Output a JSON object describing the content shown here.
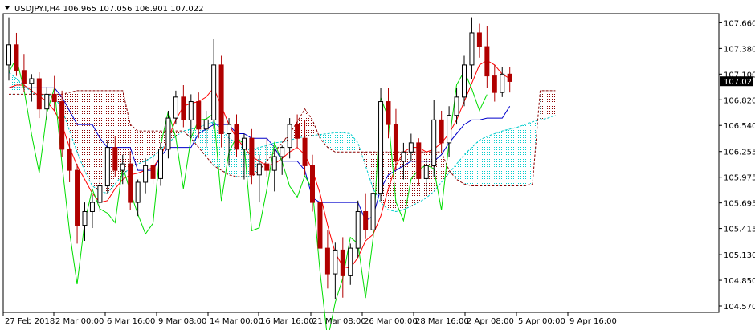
{
  "window": {
    "symbol_line": "USDJPY.I,H4  106.965 107.056 106.901 107.022",
    "menu_arrow_icon": "triangle-down-icon"
  },
  "price_axis": {
    "ticks": [
      "107.660",
      "107.380",
      "107.100",
      "106.820",
      "106.540",
      "106.255",
      "105.975",
      "105.695",
      "105.415",
      "105.130",
      "104.850",
      "104.570"
    ],
    "current_price": "107.022"
  },
  "time_axis": {
    "ticks": [
      "27 Feb 2018",
      "2 Mar 00:00",
      "6 Mar 16:00",
      "9 Mar 08:00",
      "14 Mar 00:00",
      "16 Mar 16:00",
      "21 Mar 08:00",
      "26 Mar 00:00",
      "28 Mar 16:00",
      "2 Apr 08:00",
      "5 Apr 00:00",
      "9 Apr 16:00"
    ]
  },
  "colors": {
    "background": "#ffffff",
    "bull_candle": "#000000",
    "bear_candle": "#b00000",
    "tenkan": "#ff0000",
    "kijun": "#0000cc",
    "chikou": "#00dd00",
    "kumo_up": "#00cccc",
    "kumo_down": "#8b0000",
    "price_tag_bg": "#000000",
    "price_tag_fg": "#ffffff"
  },
  "chart_data": {
    "type": "candlestick",
    "title": "USDJPY.I,H4",
    "ylim": [
      104.5,
      107.8
    ],
    "indicators": [
      "Tenkan-sen",
      "Kijun-sen",
      "Chikou Span",
      "Senkou Span A",
      "Senkou Span B"
    ],
    "candles": [
      [
        107.2,
        107.72,
        107.03,
        107.42
      ],
      [
        107.42,
        107.55,
        107.08,
        107.14
      ],
      [
        107.14,
        107.32,
        106.9,
        107.0
      ],
      [
        107.0,
        107.1,
        106.8,
        107.05
      ],
      [
        107.05,
        107.12,
        106.62,
        106.72
      ],
      [
        106.72,
        106.96,
        106.6,
        106.88
      ],
      [
        106.88,
        107.08,
        106.7,
        106.8
      ],
      [
        106.8,
        106.92,
        106.2,
        106.28
      ],
      [
        106.28,
        106.4,
        105.92,
        106.05
      ],
      [
        106.05,
        106.12,
        105.25,
        105.45
      ],
      [
        105.45,
        105.7,
        105.28,
        105.6
      ],
      [
        105.6,
        105.78,
        105.42,
        105.7
      ],
      [
        105.7,
        105.95,
        105.6,
        105.88
      ],
      [
        105.88,
        106.38,
        105.8,
        106.3
      ],
      [
        106.3,
        106.42,
        105.98,
        106.05
      ],
      [
        106.05,
        106.22,
        105.9,
        106.12
      ],
      [
        106.12,
        106.26,
        105.62,
        105.7
      ],
      [
        105.7,
        105.95,
        105.55,
        105.92
      ],
      [
        105.92,
        106.18,
        105.8,
        106.1
      ],
      [
        106.1,
        106.22,
        105.9,
        105.96
      ],
      [
        105.96,
        106.35,
        105.88,
        106.28
      ],
      [
        106.28,
        106.7,
        106.18,
        106.62
      ],
      [
        106.62,
        106.92,
        106.55,
        106.85
      ],
      [
        106.85,
        106.98,
        106.52,
        106.6
      ],
      [
        106.6,
        106.88,
        106.4,
        106.8
      ],
      [
        106.8,
        106.9,
        106.4,
        106.5
      ],
      [
        106.5,
        106.7,
        106.3,
        106.6
      ],
      [
        106.6,
        107.48,
        106.5,
        107.2
      ],
      [
        107.2,
        107.3,
        106.3,
        106.45
      ],
      [
        106.45,
        106.62,
        106.1,
        106.55
      ],
      [
        106.55,
        106.66,
        106.2,
        106.28
      ],
      [
        106.28,
        106.45,
        105.95,
        106.4
      ],
      [
        106.4,
        106.5,
        105.9,
        106.0
      ],
      [
        106.0,
        106.22,
        105.7,
        106.12
      ],
      [
        106.12,
        106.4,
        105.98,
        106.05
      ],
      [
        106.05,
        106.28,
        105.82,
        106.2
      ],
      [
        106.2,
        106.32,
        106.0,
        106.3
      ],
      [
        106.3,
        106.62,
        106.18,
        106.55
      ],
      [
        106.55,
        106.66,
        106.3,
        106.4
      ],
      [
        106.4,
        106.6,
        106.0,
        106.1
      ],
      [
        106.1,
        106.22,
        105.6,
        105.7
      ],
      [
        105.7,
        105.8,
        105.1,
        105.2
      ],
      [
        105.2,
        105.4,
        104.76,
        104.92
      ],
      [
        104.92,
        105.26,
        104.64,
        105.18
      ],
      [
        105.18,
        105.32,
        104.66,
        104.9
      ],
      [
        104.9,
        105.25,
        104.8,
        105.2
      ],
      [
        105.2,
        105.72,
        105.1,
        105.6
      ],
      [
        105.6,
        105.8,
        105.3,
        105.4
      ],
      [
        105.4,
        105.95,
        105.32,
        105.8
      ],
      [
        105.8,
        106.95,
        105.72,
        106.8
      ],
      [
        106.8,
        106.95,
        106.4,
        106.55
      ],
      [
        106.55,
        106.72,
        106.05,
        106.15
      ],
      [
        106.15,
        106.35,
        105.95,
        106.25
      ],
      [
        106.25,
        106.45,
        106.15,
        106.35
      ],
      [
        106.35,
        106.4,
        105.88,
        105.96
      ],
      [
        105.96,
        106.18,
        105.78,
        106.1
      ],
      [
        106.1,
        106.82,
        105.98,
        106.6
      ],
      [
        106.6,
        106.7,
        106.25,
        106.35
      ],
      [
        106.35,
        106.75,
        106.2,
        106.65
      ],
      [
        106.65,
        106.95,
        106.55,
        106.85
      ],
      [
        106.85,
        107.3,
        106.75,
        107.2
      ],
      [
        107.2,
        107.72,
        107.05,
        107.55
      ],
      [
        107.55,
        107.65,
        107.28,
        107.4
      ],
      [
        107.4,
        107.62,
        106.95,
        107.08
      ],
      [
        107.08,
        107.2,
        106.8,
        106.9
      ],
      [
        106.9,
        107.18,
        106.85,
        107.1
      ],
      [
        107.1,
        107.18,
        106.9,
        107.02
      ]
    ],
    "senkou_a": [
      107.12,
      107.05,
      106.98,
      106.9,
      106.86,
      106.88,
      106.85,
      106.72,
      106.48,
      106.25,
      106.04,
      105.88,
      105.82,
      105.8,
      105.9,
      106.0,
      106.08,
      106.12,
      106.15,
      106.2,
      106.28,
      106.35,
      106.42,
      106.48,
      106.5,
      106.52,
      106.55,
      106.58,
      106.5,
      106.4,
      106.35,
      106.3,
      106.28,
      106.3,
      106.32,
      106.35,
      106.36,
      106.38,
      106.4,
      106.42,
      106.43,
      106.44,
      106.45,
      106.46,
      106.46,
      106.45,
      106.35,
      106.1,
      105.85,
      105.7,
      105.62,
      105.6,
      105.62,
      105.66,
      105.7,
      105.75,
      105.82,
      105.92,
      106.02,
      106.12,
      106.22,
      106.3,
      106.38,
      106.42,
      106.45,
      106.48,
      106.5,
      106.52,
      106.55,
      106.58,
      106.6,
      106.62,
      106.65
    ],
    "senkou_b": [
      106.88,
      106.88,
      106.88,
      106.88,
      106.88,
      106.88,
      106.88,
      106.88,
      106.9,
      106.92,
      106.92,
      106.92,
      106.92,
      106.92,
      106.92,
      106.92,
      106.55,
      106.48,
      106.48,
      106.48,
      106.48,
      106.48,
      106.48,
      106.48,
      106.4,
      106.3,
      106.2,
      106.1,
      106.05,
      106.0,
      105.98,
      105.98,
      105.98,
      106.05,
      106.15,
      106.25,
      106.35,
      106.45,
      106.58,
      106.72,
      106.6,
      106.4,
      106.3,
      106.25,
      106.25,
      106.25,
      106.25,
      106.25,
      106.25,
      106.25,
      106.25,
      106.25,
      106.25,
      106.25,
      106.25,
      106.25,
      106.25,
      106.25,
      106.05,
      105.95,
      105.9,
      105.88,
      105.88,
      105.88,
      105.88,
      105.88,
      105.88,
      105.88,
      105.88,
      105.9,
      106.92,
      106.92,
      106.92
    ],
    "tenkan": [
      106.95,
      106.98,
      106.98,
      106.92,
      106.86,
      106.8,
      106.7,
      106.55,
      106.3,
      106.1,
      105.95,
      105.8,
      105.7,
      105.72,
      105.85,
      105.95,
      106.0,
      106.02,
      106.05,
      106.08,
      106.2,
      106.4,
      106.6,
      106.75,
      106.78,
      106.8,
      106.85,
      106.95,
      106.75,
      106.55,
      106.4,
      106.3,
      106.2,
      106.15,
      106.1,
      106.12,
      106.18,
      106.25,
      106.3,
      106.22,
      106.05,
      105.8,
      105.45,
      105.15,
      105.0,
      104.98,
      105.1,
      105.28,
      105.35,
      105.55,
      105.85,
      106.1,
      106.25,
      106.3,
      106.3,
      106.25,
      106.28,
      106.35,
      106.45,
      106.6,
      106.8,
      107.0,
      107.2,
      107.25,
      107.2,
      107.1,
      107.05
    ],
    "kijun": [
      106.95,
      106.95,
      106.95,
      106.95,
      106.95,
      106.95,
      106.95,
      106.85,
      106.7,
      106.55,
      106.55,
      106.55,
      106.4,
      106.3,
      106.3,
      106.3,
      106.3,
      106.05,
      106.05,
      106.05,
      106.2,
      106.3,
      106.3,
      106.3,
      106.3,
      106.45,
      106.5,
      106.55,
      106.55,
      106.55,
      106.45,
      106.45,
      106.4,
      106.4,
      106.4,
      106.3,
      106.15,
      106.15,
      106.15,
      106.05,
      105.75,
      105.7,
      105.7,
      105.7,
      105.7,
      105.7,
      105.7,
      105.5,
      105.55,
      105.85,
      106.0,
      106.05,
      106.1,
      106.15,
      106.15,
      106.15,
      106.15,
      106.22,
      106.35,
      106.45,
      106.55,
      106.6,
      106.6,
      106.62,
      106.62,
      106.62,
      106.75
    ]
  }
}
